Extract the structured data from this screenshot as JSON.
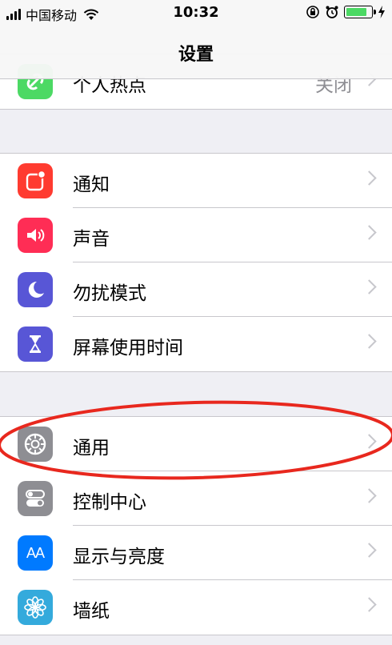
{
  "status_bar": {
    "carrier": "中国移动",
    "time": "10:32",
    "battery_level": 0.84
  },
  "nav": {
    "title": "设置"
  },
  "colors": {
    "hotspot": "#4cd964",
    "notifications": "#ff3b30",
    "sounds": "#ff2d55",
    "dnd": "#5856d6",
    "screen_time": "#5856d6",
    "general": "#8e8e93",
    "control_center": "#8e8e93",
    "display": "#007aff",
    "wallpaper": "#34aadc",
    "annotation": "#e8281e"
  },
  "groups": [
    {
      "items": [
        {
          "label": "个人热点",
          "value": "关闭",
          "icon": "link-icon"
        }
      ]
    },
    {
      "items": [
        {
          "label": "通知",
          "icon": "notifications-icon"
        },
        {
          "label": "声音",
          "icon": "speaker-icon"
        },
        {
          "label": "勿扰模式",
          "icon": "moon-icon"
        },
        {
          "label": "屏幕使用时间",
          "icon": "hourglass-icon"
        }
      ]
    },
    {
      "items": [
        {
          "label": "通用",
          "icon": "gear-icon"
        },
        {
          "label": "控制中心",
          "icon": "toggle-icon"
        },
        {
          "label": "显示与亮度",
          "icon": "text-size-icon",
          "icon_text": "AA"
        },
        {
          "label": "墙纸",
          "icon": "flower-icon"
        }
      ]
    }
  ]
}
